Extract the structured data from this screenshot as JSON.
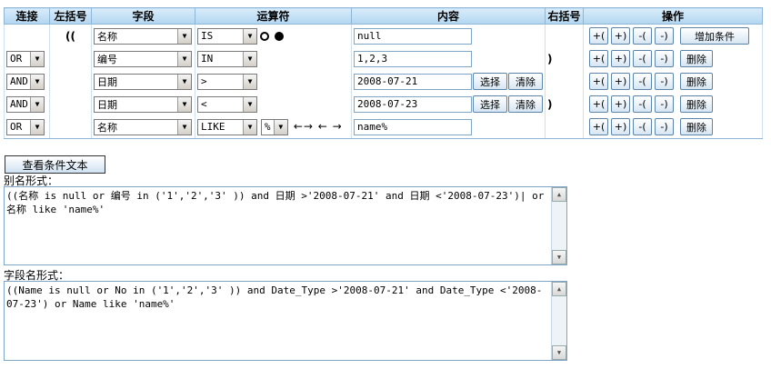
{
  "headers": [
    "连接",
    "左括号",
    "字段",
    "运算符",
    "内容",
    "右括号",
    "操作"
  ],
  "rows": [
    {
      "connect": "",
      "lparen": "((",
      "field": "名称",
      "op": "IS",
      "radio": true,
      "arrows": "",
      "content": "null",
      "select_btns": false,
      "rparen": "",
      "action": "增加条件"
    },
    {
      "connect": "OR",
      "lparen": "",
      "field": "编号",
      "op": "IN",
      "radio": false,
      "arrows": "",
      "content": "1,2,3",
      "select_btns": false,
      "rparen": ")",
      "action": "删除"
    },
    {
      "connect": "AND",
      "lparen": "",
      "field": "日期",
      "op": ">",
      "radio": false,
      "arrows": "",
      "content": "2008-07-21",
      "select_btns": true,
      "rparen": "",
      "action": "删除"
    },
    {
      "connect": "AND",
      "lparen": "",
      "field": "日期",
      "op": "<",
      "radio": false,
      "arrows": "",
      "content": "2008-07-23",
      "select_btns": true,
      "rparen": ")",
      "action": "删除"
    },
    {
      "connect": "OR",
      "lparen": "",
      "field": "名称",
      "op": "LIKE",
      "wildcard": "%",
      "radio": false,
      "arrows": "←→ ← →",
      "content": "name%",
      "select_btns": false,
      "rparen": "",
      "action": "删除"
    }
  ],
  "paren_buttons": [
    "+(",
    "+)",
    "-(",
    "-)"
  ],
  "select_label": "选择",
  "clear_label": "清除",
  "view_button": "查看条件文本",
  "alias_label": "别名形式：",
  "alias_text": "((名称 is null or 编号 in ('1','2','3' )) and 日期 >'2008-07-21' and 日期 <'2008-07-23')| or 名称 like 'name%'",
  "field_label": "字段名形式：",
  "field_text": "((Name is null or No in ('1','2','3' )) and Date_Type >'2008-07-21' and Date_Type <'2008-07-23') or Name like 'name%'"
}
